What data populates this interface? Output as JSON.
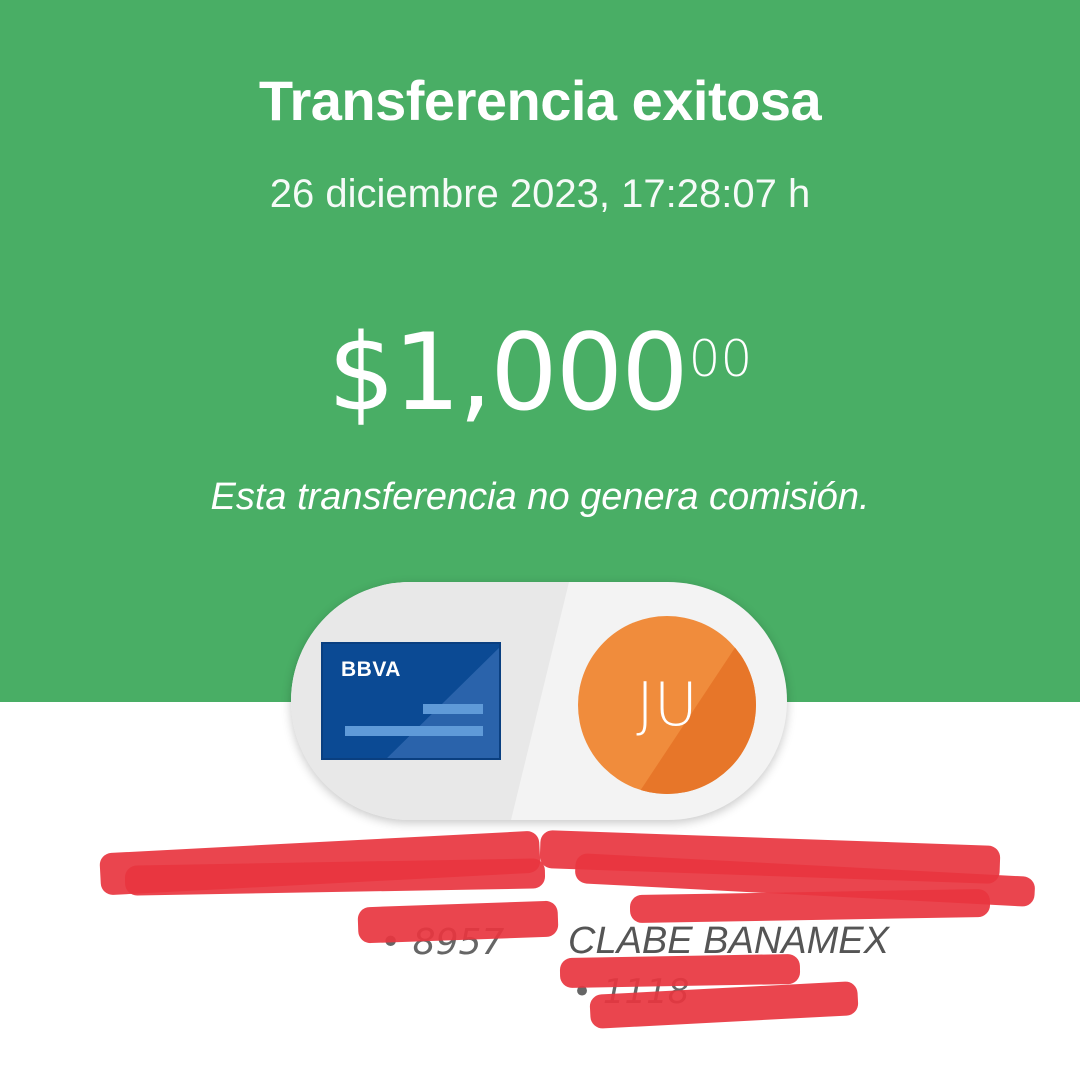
{
  "header": {
    "title": "Transferencia exitosa",
    "datetime": "26 diciembre 2023, 17:28:07 h",
    "amount_main": "$1,000",
    "amount_cents": "00",
    "note": "Esta transferencia no genera comisión."
  },
  "origin": {
    "bank_brand": "BBVA",
    "account_masked": "• 8957"
  },
  "destination": {
    "initials": "JU",
    "account_type": "CLABE BANAMEX",
    "account_masked": "• 1118"
  },
  "colors": {
    "header_green": "#49ae65",
    "card_blue": "#0b4a94",
    "avatar_orange": "#f08c3c",
    "redaction_red": "#e8353f"
  }
}
